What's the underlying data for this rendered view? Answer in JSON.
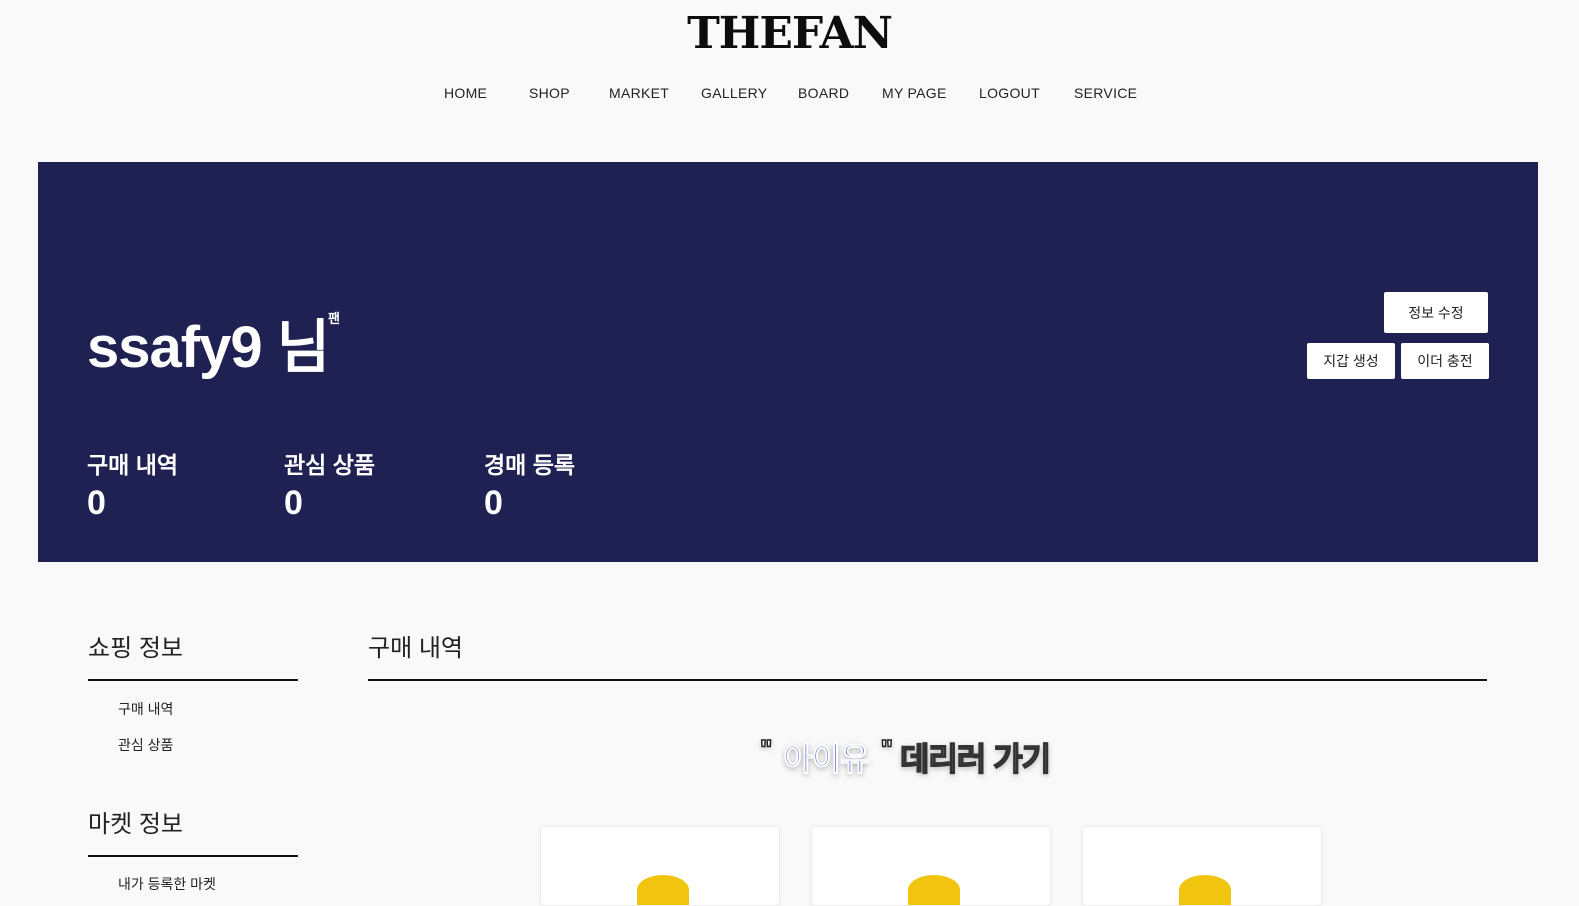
{
  "header": {
    "logo": "THEFAN",
    "nav": [
      "HOME",
      "SHOP",
      "MARKET",
      "GALLERY",
      "BOARD",
      "MY PAGE",
      "LOGOUT",
      "SERVICE"
    ]
  },
  "hero": {
    "username": "ssafy9 님",
    "tier": "팬",
    "buttons": {
      "edit_profile": "정보 수정",
      "create_wallet": "지갑 생성",
      "charge_ether": "이더 충전"
    },
    "stats": [
      {
        "label": "구매 내역",
        "value": "0"
      },
      {
        "label": "관심 상품",
        "value": "0"
      },
      {
        "label": "경매 등록",
        "value": "0"
      }
    ],
    "background_color": "#1f2152"
  },
  "sidebar": {
    "shopping": {
      "title": "쇼핑 정보",
      "items": [
        "구매 내역",
        "관심 상품"
      ]
    },
    "market": {
      "title": "마켓 정보",
      "items": [
        "내가 등록한 마켓"
      ]
    }
  },
  "main": {
    "title": "구매 내역",
    "banner": {
      "open_quote": "\"",
      "artist": "아이유",
      "close_quote": "\"",
      "text": "데리러 가기"
    }
  }
}
